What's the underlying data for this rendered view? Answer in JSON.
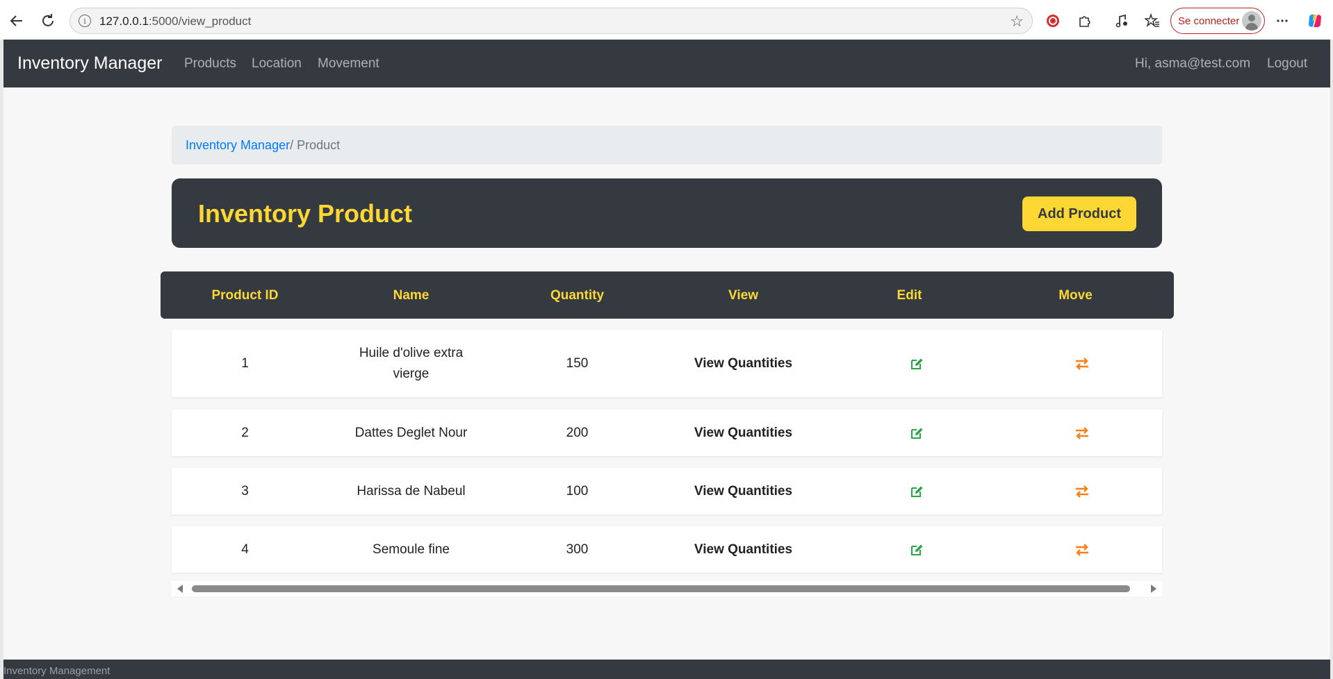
{
  "browser": {
    "url_host": "127.0.0.1",
    "url_path": ":5000/view_product",
    "signin_label": "Se connecter",
    "icons": [
      "back-icon",
      "reload-icon",
      "info-icon",
      "star-icon",
      "extension-shield-icon",
      "puzzle-icon",
      "music-icon",
      "favorites-icon",
      "more-icon",
      "copilot-icon"
    ]
  },
  "navbar": {
    "brand": "Inventory Manager",
    "links": [
      "Products",
      "Location",
      "Movement"
    ],
    "greeting": "Hi, asma@test.com",
    "logout": "Logout"
  },
  "breadcrumb": {
    "home": "Inventory Manager",
    "separator": "/ ",
    "current": "Product"
  },
  "header": {
    "title": "Inventory Product",
    "add_button": "Add Product"
  },
  "table": {
    "columns": [
      "Product ID",
      "Name",
      "Quantity",
      "View",
      "Edit",
      "Move"
    ],
    "rows": [
      {
        "id": "1",
        "name_line1": "Huile d'olive extra",
        "name_line2": "vierge",
        "quantity": "150",
        "view": "View Quantities"
      },
      {
        "id": "2",
        "name_line1": "Dattes Deglet Nour",
        "name_line2": "",
        "quantity": "200",
        "view": "View Quantities"
      },
      {
        "id": "3",
        "name_line1": "Harissa de Nabeul",
        "name_line2": "",
        "quantity": "100",
        "view": "View Quantities"
      },
      {
        "id": "4",
        "name_line1": "Semoule fine",
        "name_line2": "",
        "quantity": "300",
        "view": "View Quantities"
      }
    ]
  },
  "footer": {
    "text": "Inventory Management"
  },
  "colors": {
    "navbar_bg": "#343a40",
    "accent_yellow": "#fdd835",
    "link_blue": "#007bff",
    "edit_green": "#28a745",
    "move_orange": "#fd7e14"
  }
}
